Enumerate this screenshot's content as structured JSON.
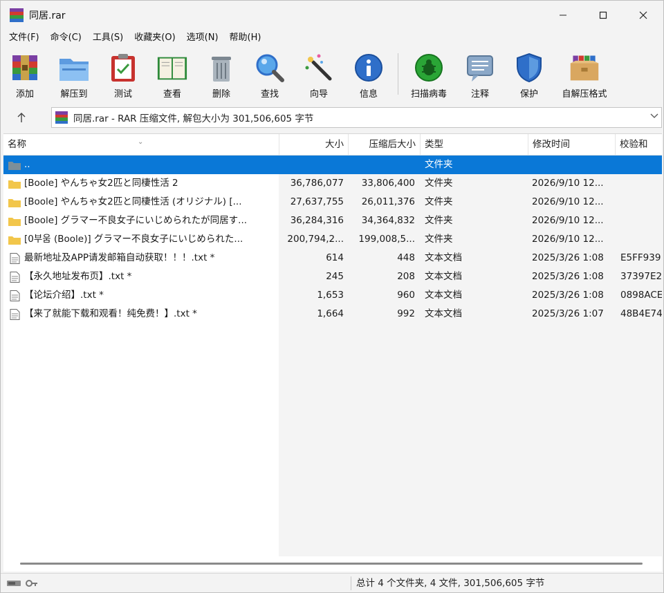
{
  "window": {
    "title": "同居.rar"
  },
  "menu": [
    "文件(F)",
    "命令(C)",
    "工具(S)",
    "收藏夹(O)",
    "选项(N)",
    "帮助(H)"
  ],
  "toolbar": [
    {
      "label": "添加",
      "icon": "add-archive-icon"
    },
    {
      "label": "解压到",
      "icon": "extract-folder-icon"
    },
    {
      "label": "测试",
      "icon": "test-clipboard-icon"
    },
    {
      "label": "查看",
      "icon": "view-book-icon"
    },
    {
      "label": "删除",
      "icon": "trash-icon"
    },
    {
      "label": "查找",
      "icon": "magnifier-icon"
    },
    {
      "label": "向导",
      "icon": "wizard-wand-icon"
    },
    {
      "label": "信息",
      "icon": "info-icon"
    },
    {
      "label": "扫描病毒",
      "icon": "virus-scan-icon"
    },
    {
      "label": "注释",
      "icon": "comment-icon"
    },
    {
      "label": "保护",
      "icon": "shield-icon"
    },
    {
      "label": "自解压格式",
      "icon": "sfx-box-icon"
    }
  ],
  "address": {
    "text": "同居.rar - RAR 压缩文件, 解包大小为 301,506,605 字节"
  },
  "columns": {
    "name": "名称",
    "size": "大小",
    "packed": "压缩后大小",
    "type": "类型",
    "mtime": "修改时间",
    "crc": "校验和"
  },
  "files": [
    {
      "name": "..",
      "size": "",
      "packed": "",
      "type": "文件夹",
      "mtime": "",
      "crc": "",
      "kind": "parent",
      "selected": true
    },
    {
      "name": "[Boole] やんちゃ女2匹と同棲性活 2",
      "size": "36,786,077",
      "packed": "33,806,400",
      "type": "文件夹",
      "mtime": "2026/9/10 12...",
      "crc": "",
      "kind": "folder",
      "selected": false
    },
    {
      "name": "[Boole] やんちゃ女2匹と同棲性活 (オリジナル) [...",
      "size": "27,637,755",
      "packed": "26,011,376",
      "type": "文件夹",
      "mtime": "2026/9/10 12...",
      "crc": "",
      "kind": "folder",
      "selected": false
    },
    {
      "name": "[Boole] グラマー不良女子にいじめられたが同居す...",
      "size": "36,284,316",
      "packed": "34,364,832",
      "type": "文件夹",
      "mtime": "2026/9/10 12...",
      "crc": "",
      "kind": "folder",
      "selected": false
    },
    {
      "name": "[0부움 (Boole)] グラマー不良女子にいじめられた...",
      "size": "200,794,2...",
      "packed": "199,008,5...",
      "type": "文件夹",
      "mtime": "2026/9/10 12...",
      "crc": "",
      "kind": "folder",
      "selected": false
    },
    {
      "name": "最新地址及APP请发邮箱自动获取！！！.txt *",
      "size": "614",
      "packed": "448",
      "type": "文本文档",
      "mtime": "2025/3/26 1:08",
      "crc": "E5FF939",
      "kind": "text",
      "selected": false
    },
    {
      "name": "【永久地址发布页】.txt *",
      "size": "245",
      "packed": "208",
      "type": "文本文档",
      "mtime": "2025/3/26 1:08",
      "crc": "37397E2",
      "kind": "text",
      "selected": false
    },
    {
      "name": "【论坛介绍】.txt *",
      "size": "1,653",
      "packed": "960",
      "type": "文本文档",
      "mtime": "2025/3/26 1:08",
      "crc": "0898ACE",
      "kind": "text",
      "selected": false
    },
    {
      "name": "【来了就能下载和观看！纯免费！】.txt *",
      "size": "1,664",
      "packed": "992",
      "type": "文本文档",
      "mtime": "2025/3/26 1:07",
      "crc": "48B4E74",
      "kind": "text",
      "selected": false
    }
  ],
  "status": {
    "text": "总计 4 个文件夹, 4 文件, 301,506,605 字节"
  },
  "colors": {
    "selection": "#0a78d7",
    "folder": "#f2c64b",
    "rar_purple": "#7b3fa3",
    "rar_red": "#d23b2f",
    "rar_green": "#3a9a3e",
    "rar_blue": "#2f6fc9"
  }
}
